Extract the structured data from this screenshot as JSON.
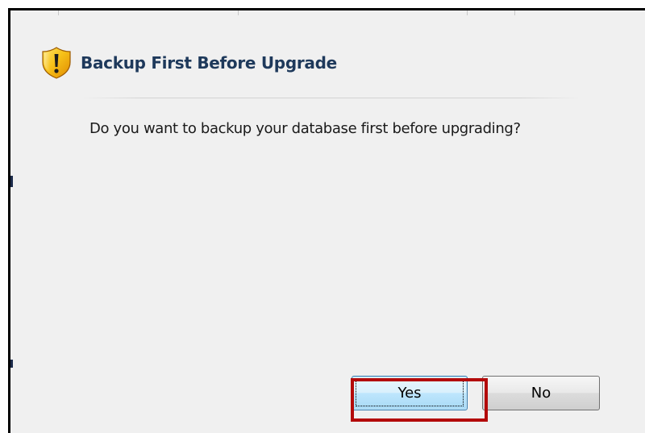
{
  "dialog": {
    "title": "Backup First Before Upgrade",
    "message": "Do you want to backup your database first before upgrading?",
    "icon": "shield-warning-icon"
  },
  "buttons": {
    "yes_label": "Yes",
    "no_label": "No"
  },
  "colors": {
    "title_text": "#1e395b",
    "dialog_background": "#f0f0f0",
    "highlight": "#b30a0a",
    "shield_yellow": "#f7c219",
    "shield_orange": "#e08a00"
  }
}
